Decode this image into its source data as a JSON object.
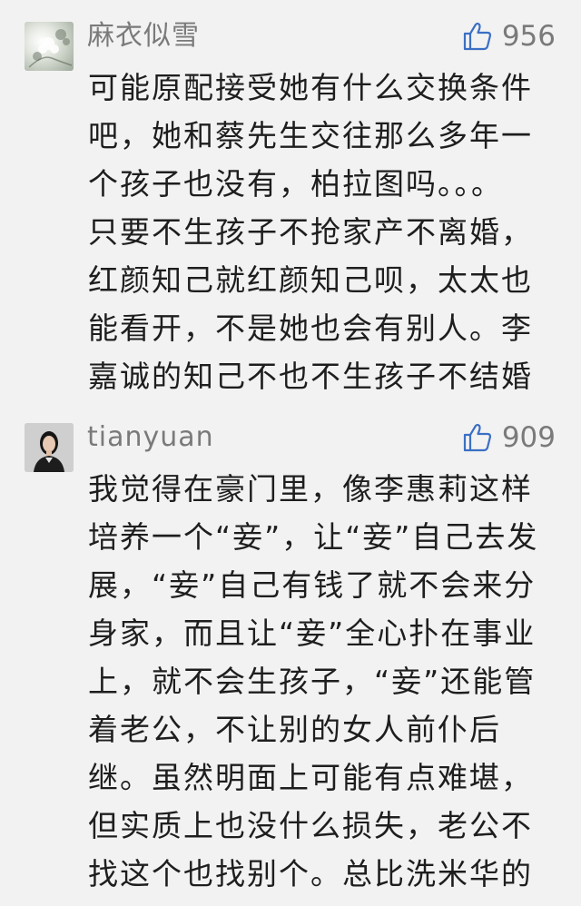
{
  "comments": [
    {
      "username": "麻衣似雪",
      "likes": "956",
      "avatar_icon": "flower-avatar-icon",
      "text": "可能原配接受她有什么交换条件\n吧，她和蔡先生交往那么多年一\n个孩子也没有，柏拉图吗。。。\n只要不生孩子不抢家产不离婚，\n红颜知己就红颜知己呗，太太也\n能看开，不是她也会有别人。李\n嘉诚的知己不也不生孩子不结婚"
    },
    {
      "username": "tianyuan",
      "likes": "909",
      "avatar_icon": "person-avatar-icon",
      "text": "我觉得在豪门里，像李惠莉这样\n培养一个“妾”，让“妾”自己去发\n展，“妾”自己有钱了就不会来分\n身家，而且让“妾”全心扑在事业\n上，就不会生孩子，“妾”还能管\n着老公，不让别的女人前仆后\n继。虽然明面上可能有点难堪，\n但实质上也没什么损失，老公不\n找这个也找别个。总比洗米华的\n太太好多了。"
    }
  ],
  "colors": {
    "background": "#f2f2f2",
    "meta_text": "#7a7a7a",
    "body_text": "#1e1e1e"
  },
  "icons": {
    "like": "thumbs-up-icon"
  }
}
